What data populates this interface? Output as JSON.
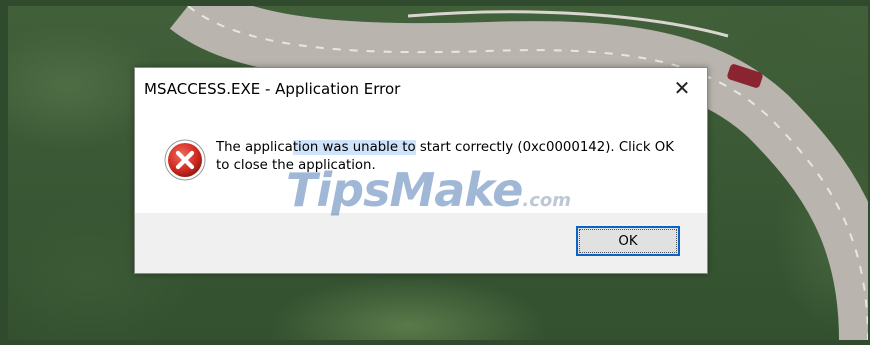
{
  "dialog": {
    "title": "MSACCESS.EXE - Application Error",
    "close_glyph": "✕",
    "icon": "error-icon",
    "message_part1": "The applica",
    "message_highlight": "tion was unable to",
    "message_part2": " start correctly (0xc0000142). Click OK to close the application.",
    "ok_label": "OK"
  },
  "watermark": {
    "main": "TipsMake",
    "sub": ".com"
  },
  "colors": {
    "ok_focus_border": "#0a64c8",
    "error_red": "#d32f2f",
    "selection_highlight": "#cfe3fb"
  }
}
